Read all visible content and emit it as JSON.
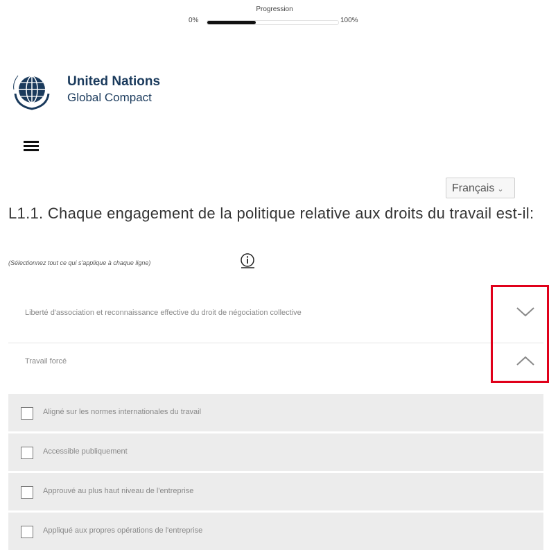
{
  "progress": {
    "title": "Progression",
    "min_label": "0%",
    "max_label": "100%",
    "value_percent": 37
  },
  "logo": {
    "line1": "United Nations",
    "line2": "Global Compact",
    "emblem_text": "UN GLOBAL COMPACT"
  },
  "menu": {
    "icon": "hamburger-icon"
  },
  "language": {
    "selected": "Français"
  },
  "question": {
    "text": "L1.1. Chaque engagement de la politique relative aux droits du travail est-il:",
    "hint": "(Sélectionnez tout ce qui s'applique à chaque ligne)",
    "info_icon": "info-icon"
  },
  "rows": [
    {
      "label": "Liberté d'association et reconnaissance effective du droit de négociation collective",
      "state": "collapsed",
      "icon": "chevron-down-icon"
    },
    {
      "label": "Travail forcé",
      "state": "expanded",
      "icon": "chevron-up-icon"
    }
  ],
  "options": [
    {
      "label": "Aligné sur les normes internationales du travail",
      "checked": false
    },
    {
      "label": "Accessible publiquement",
      "checked": false
    },
    {
      "label": "Approuvé au plus haut niveau de l'entreprise",
      "checked": false
    },
    {
      "label": "Appliqué aux propres opérations de l'entreprise",
      "checked": false
    }
  ],
  "colors": {
    "highlight": "#e0001a",
    "brand": "#1a3a5c",
    "option_bg": "#ececec"
  }
}
